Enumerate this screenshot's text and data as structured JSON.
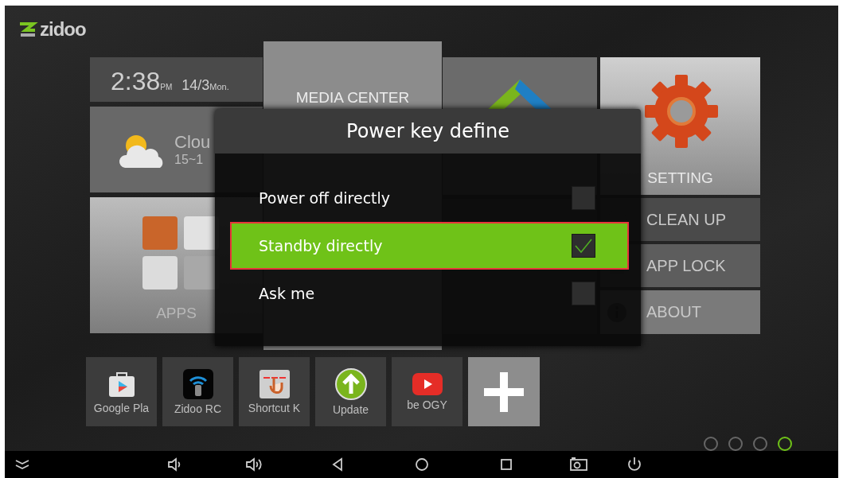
{
  "logo": {
    "text": "zidoo"
  },
  "clock": {
    "time": "2:38",
    "meridiem": "PM",
    "date": "14/3",
    "weekday": "Mon."
  },
  "weather": {
    "condition": "Clou",
    "temperature": "15~1"
  },
  "apps_tile": {
    "label": "APPS"
  },
  "media_tile": {
    "label": "MEDIA CENTER"
  },
  "setting_tile": {
    "label": "SETTING"
  },
  "side_menu": [
    {
      "kind": "clean",
      "label": "CLEAN UP"
    },
    {
      "kind": "lock",
      "label": "APP LOCK"
    },
    {
      "kind": "info",
      "label": "ABOUT"
    }
  ],
  "shortcuts": [
    {
      "kind": "store",
      "label": "Google Pla"
    },
    {
      "kind": "remote",
      "label": "Zidoo RC"
    },
    {
      "kind": "shortcut",
      "label": "Shortcut K"
    },
    {
      "kind": "update",
      "label": "Update"
    },
    {
      "kind": "video",
      "label": "be OGY"
    },
    {
      "kind": "add"
    }
  ],
  "page_dots": [
    {
      "selected": false
    },
    {
      "selected": false
    },
    {
      "selected": false
    },
    {
      "selected": true
    }
  ],
  "dialog": {
    "title": "Power key define",
    "options": [
      {
        "label": "Power off directly",
        "selected": false,
        "checked": false
      },
      {
        "label": "Standby directly",
        "selected": true,
        "checked": true
      },
      {
        "label": "Ask me",
        "selected": false,
        "checked": false
      }
    ]
  }
}
